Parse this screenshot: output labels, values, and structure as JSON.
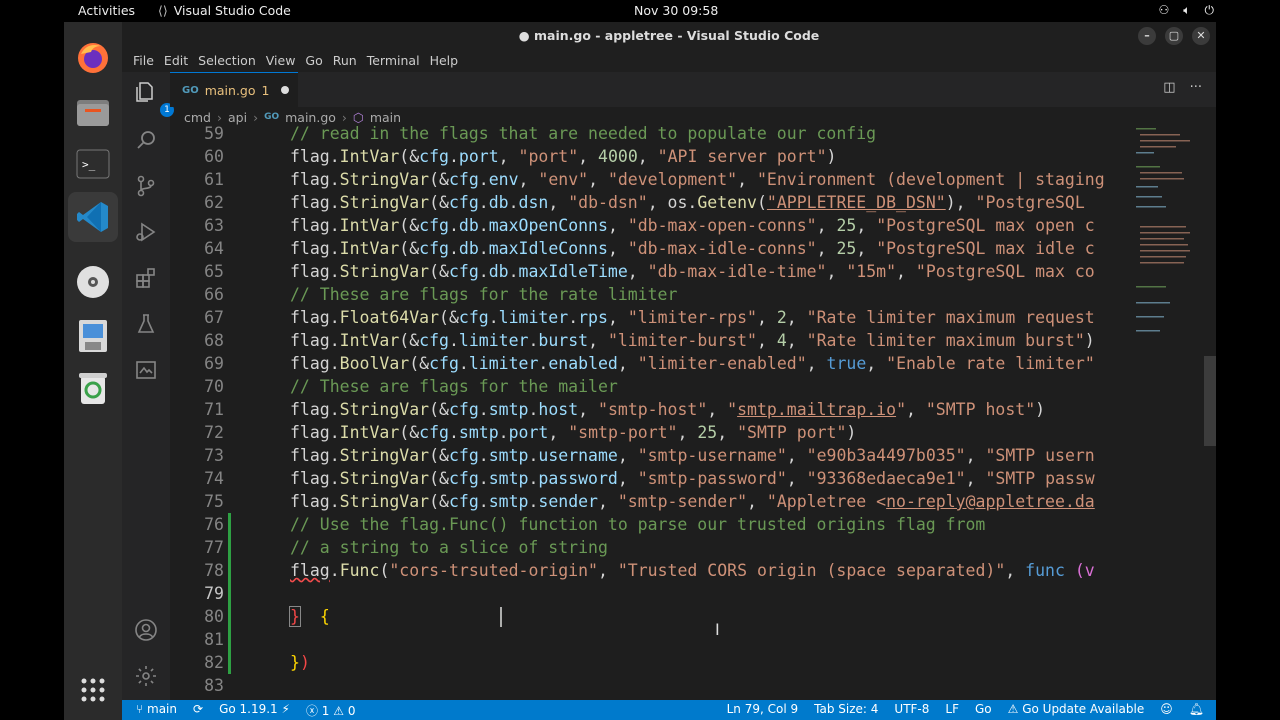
{
  "topbar": {
    "activities": "Activities",
    "app_name": "Visual Studio Code",
    "clock": "Nov 30  09:58"
  },
  "window": {
    "title": "● main.go - appletree - Visual Studio Code",
    "minimize": "–",
    "maximize": "▢",
    "close": "✕"
  },
  "menu": [
    "File",
    "Edit",
    "Selection",
    "View",
    "Go",
    "Run",
    "Terminal",
    "Help"
  ],
  "activitybar": {
    "explorer_badge": "1"
  },
  "tab": {
    "icon_text": "GO",
    "name": "main.go",
    "problems": "1"
  },
  "breadcrumb": [
    "cmd",
    "api",
    "main.go",
    "main"
  ],
  "editor": {
    "first_line": 59,
    "current_line": 79
  },
  "status": {
    "branch": "main",
    "go_version": "Go 1.19.1",
    "errors": "1",
    "warnings": "0",
    "position": "Ln 79, Col 9",
    "tab_size": "Tab Size: 4",
    "encoding": "UTF-8",
    "eol": "LF",
    "language": "Go",
    "update": "Go Update Available"
  },
  "colors": {
    "accent": "#007acc",
    "editor_bg": "#1e1e1e",
    "comment": "#6a9955",
    "string": "#ce9178"
  }
}
